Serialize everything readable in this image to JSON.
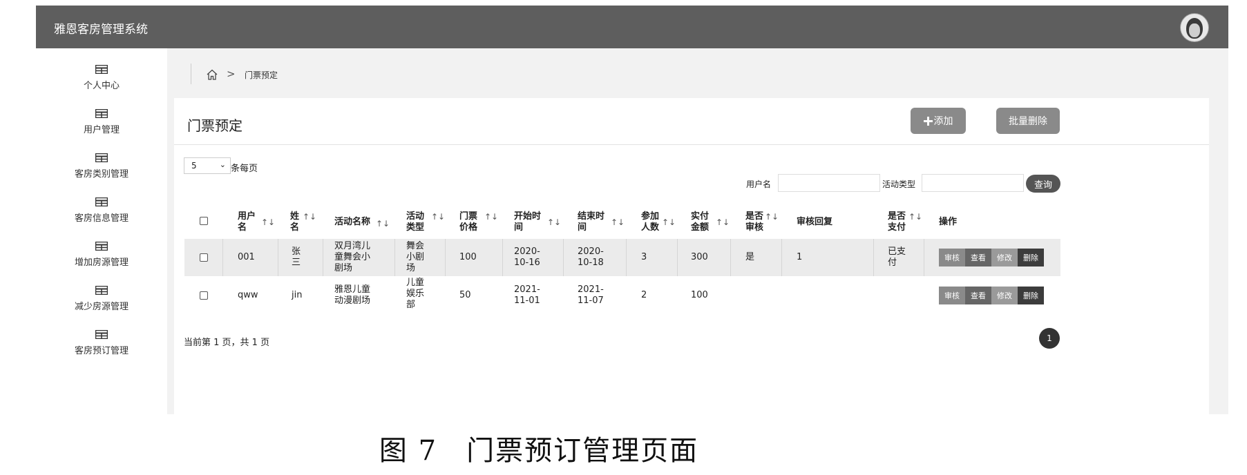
{
  "header": {
    "app_title": "雅恩客房管理系统"
  },
  "sidebar": {
    "items": [
      {
        "label": "个人中心"
      },
      {
        "label": "用户管理"
      },
      {
        "label": "客房类别管理"
      },
      {
        "label": "客房信息管理"
      },
      {
        "label": "增加房源管理"
      },
      {
        "label": "减少房源管理"
      },
      {
        "label": "客房预订管理"
      }
    ]
  },
  "breadcrumb": {
    "separator": ">",
    "current": "门票预定"
  },
  "panel": {
    "title": "门票预定",
    "add_label": "添加",
    "add_icon": "plus-icon",
    "batch_delete_label": "批量删除"
  },
  "pagination_control": {
    "page_size": "5",
    "per_page_label": "条每页"
  },
  "search": {
    "username_label": "用户名",
    "username_value": "",
    "activity_type_label": "活动类型",
    "activity_type_value": "",
    "query_label": "查询"
  },
  "table": {
    "columns": [
      {
        "label": "用户\n名",
        "sortable": true
      },
      {
        "label": "姓\n名",
        "sortable": true
      },
      {
        "label": "活动名称",
        "sortable": true
      },
      {
        "label": "活动\n类型",
        "sortable": true
      },
      {
        "label": "门票\n价格",
        "sortable": true
      },
      {
        "label": "开始时\n间",
        "sortable": true
      },
      {
        "label": "结束时\n间",
        "sortable": true
      },
      {
        "label": "参加\n人数",
        "sortable": true
      },
      {
        "label": "实付\n金额",
        "sortable": true
      },
      {
        "label": "是否\n审核",
        "sortable": true
      },
      {
        "label": "审核回复",
        "sortable": false
      },
      {
        "label": "是否\n支付",
        "sortable": true
      },
      {
        "label": "操作",
        "sortable": false
      }
    ],
    "sort_glyph": "↑↓",
    "rows": [
      {
        "cells": [
          "001",
          "张\n三",
          "双月湾儿\n童舞会小\n剧场",
          "舞会\n小剧\n场",
          "100",
          "2020-\n10-16",
          "2020-\n10-18",
          "3",
          "300",
          "是",
          "1",
          "已支\n付"
        ],
        "actions": [
          "审核",
          "查看",
          "修改",
          "删除"
        ]
      },
      {
        "cells": [
          "qww",
          "jin",
          "雅恩儿童\n动漫剧场",
          "儿童\n娱乐\n部",
          "50",
          "2021-\n11-01",
          "2021-\n11-07",
          "2",
          "100",
          "",
          "",
          ""
        ],
        "actions": [
          "审核",
          "查看",
          "修改",
          "删除"
        ]
      }
    ]
  },
  "footer": {
    "info": "当前第 1 页，共 1 页",
    "current_page": "1"
  },
  "caption": "图 7　门票预订管理页面"
}
